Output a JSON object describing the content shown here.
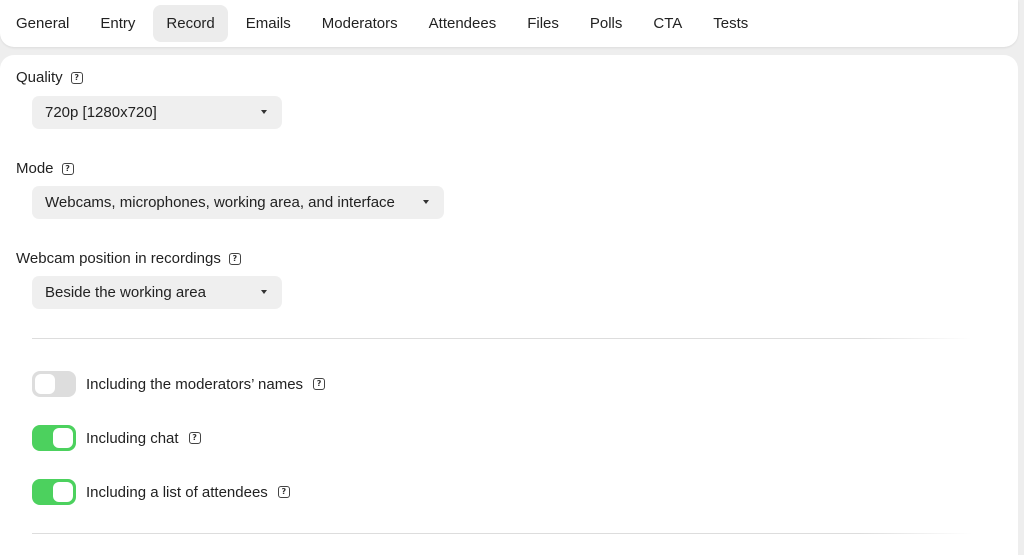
{
  "tabs": [
    {
      "label": "General",
      "active": false
    },
    {
      "label": "Entry",
      "active": false
    },
    {
      "label": "Record",
      "active": true
    },
    {
      "label": "Emails",
      "active": false
    },
    {
      "label": "Moderators",
      "active": false
    },
    {
      "label": "Attendees",
      "active": false
    },
    {
      "label": "Files",
      "active": false
    },
    {
      "label": "Polls",
      "active": false
    },
    {
      "label": "CTA",
      "active": false
    },
    {
      "label": "Tests",
      "active": false
    }
  ],
  "quality": {
    "label": "Quality",
    "value": "720p [1280x720]"
  },
  "mode": {
    "label": "Mode",
    "value": "Webcams, microphones, working area, and interface"
  },
  "webcam_position": {
    "label": "Webcam position in recordings",
    "value": "Beside the working area"
  },
  "toggles": [
    {
      "label": "Including the moderators’ names",
      "on": false
    },
    {
      "label": "Including chat",
      "on": true
    },
    {
      "label": "Including a list of attendees",
      "on": true
    }
  ],
  "help_glyph": "?",
  "colors": {
    "toggle_on": "#4cd15e",
    "toggle_off": "#dddddd",
    "active_tab": "#ececec"
  }
}
